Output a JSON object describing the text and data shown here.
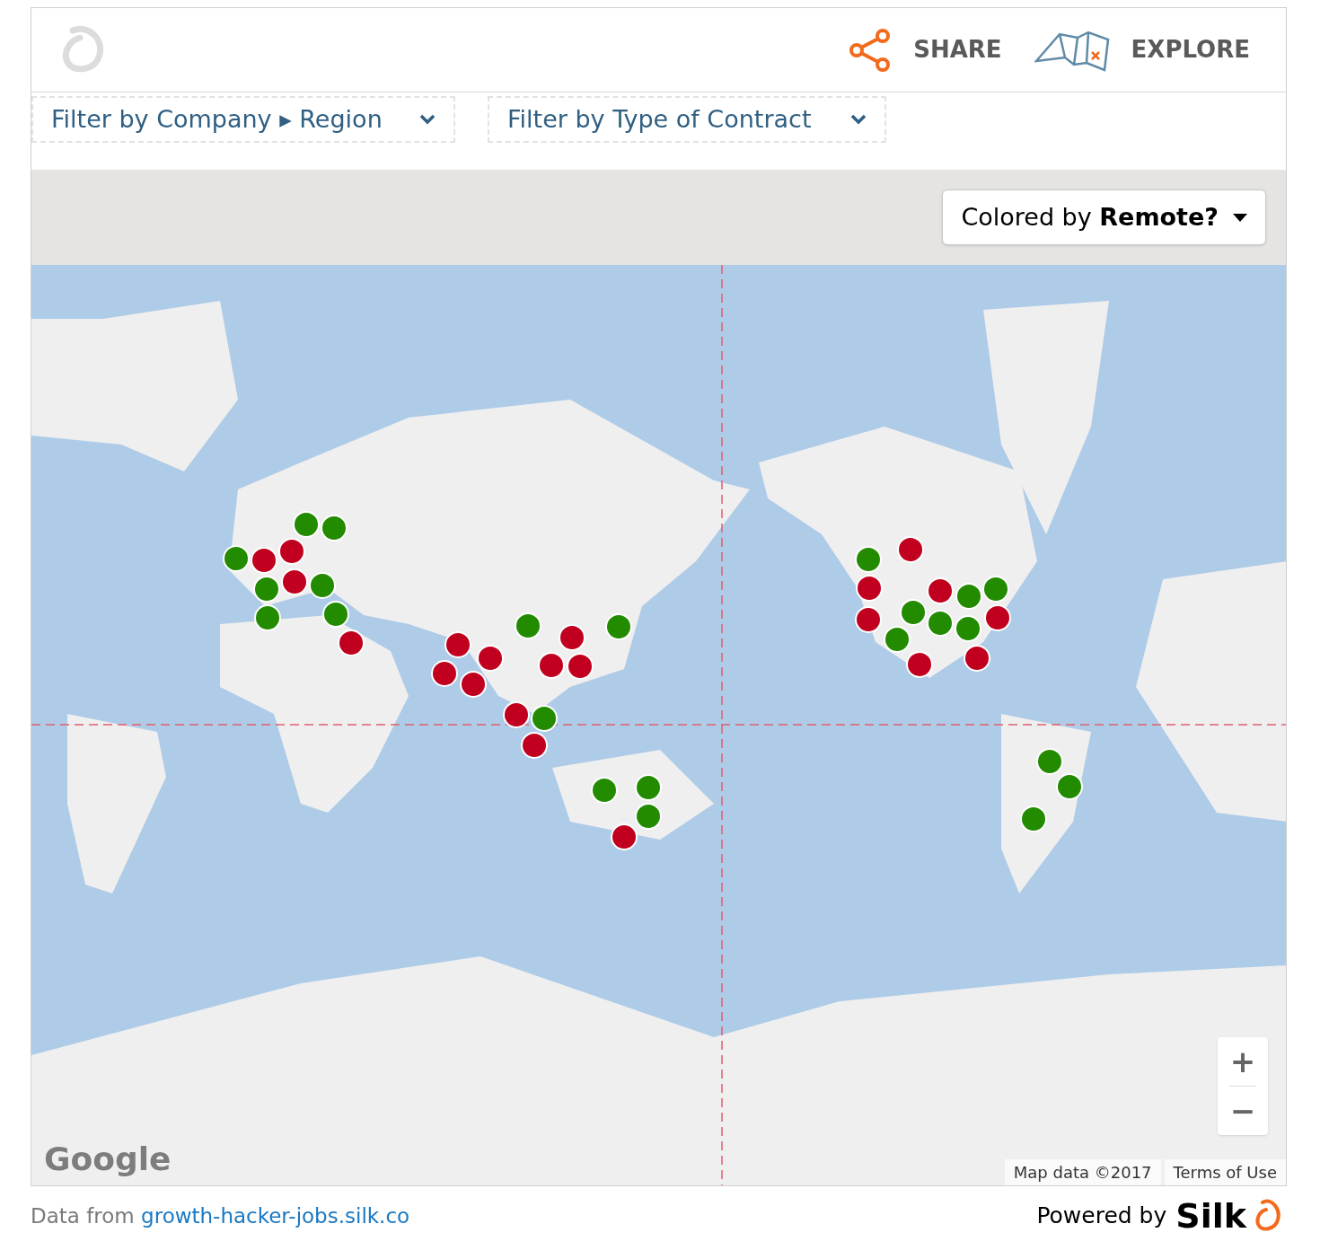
{
  "header": {
    "actions": [
      {
        "kind": "share",
        "label": "SHARE"
      },
      {
        "kind": "explore",
        "label": "EXPLORE"
      }
    ]
  },
  "filters": [
    {
      "label": "Filter by Company ▸ Region"
    },
    {
      "label": "Filter by Type of Contract"
    }
  ],
  "color_selector": {
    "label": "Colored by **Remote?**"
  },
  "map": {
    "kind": "picture",
    "logo": "Google",
    "zoom_in": "+",
    "zoom_out": "−",
    "attribution": "Map data ©2017",
    "terms": "Terms of Use",
    "markers": [
      {
        "color": "#228b00"
      },
      {
        "color": "#c0001e"
      },
      {
        "color": "#c0001e"
      },
      {
        "color": "#228b00"
      },
      {
        "color": "#228b00"
      },
      {
        "color": "#228b00"
      },
      {
        "color": "#c0001e"
      },
      {
        "color": "#228b00"
      },
      {
        "color": "#228b00"
      },
      {
        "color": "#228b00"
      },
      {
        "color": "#c0001e"
      },
      {
        "color": "#c0001e"
      },
      {
        "color": "#c0001e"
      },
      {
        "color": "#c0001e"
      },
      {
        "color": "#c0001e"
      },
      {
        "color": "#228b00"
      },
      {
        "color": "#c0001e"
      },
      {
        "color": "#c0001e"
      },
      {
        "color": "#c0001e"
      },
      {
        "color": "#228b00"
      },
      {
        "color": "#c0001e"
      },
      {
        "color": "#228b00"
      },
      {
        "color": "#c0001e"
      },
      {
        "color": "#228b00"
      },
      {
        "color": "#228b00"
      },
      {
        "color": "#228b00"
      },
      {
        "color": "#c0001e"
      },
      {
        "color": "#228b00"
      },
      {
        "color": "#c0001e"
      },
      {
        "color": "#c0001e"
      },
      {
        "color": "#c0001e"
      },
      {
        "color": "#228b00"
      },
      {
        "color": "#228b00"
      },
      {
        "color": "#c0001e"
      },
      {
        "color": "#228b00"
      },
      {
        "color": "#c0001e"
      },
      {
        "color": "#228b00"
      },
      {
        "color": "#228b00"
      },
      {
        "color": "#228b00"
      },
      {
        "color": "#c0001e"
      },
      {
        "color": "#c0001e"
      },
      {
        "color": "#228b00"
      },
      {
        "color": "#228b00"
      },
      {
        "color": "#228b00"
      }
    ]
  },
  "footer": {
    "source_prefix": "Data from",
    "source_link": "growth-hacker-jobs.silk.co",
    "powered_by": "Powered by",
    "brand": "Silk"
  }
}
